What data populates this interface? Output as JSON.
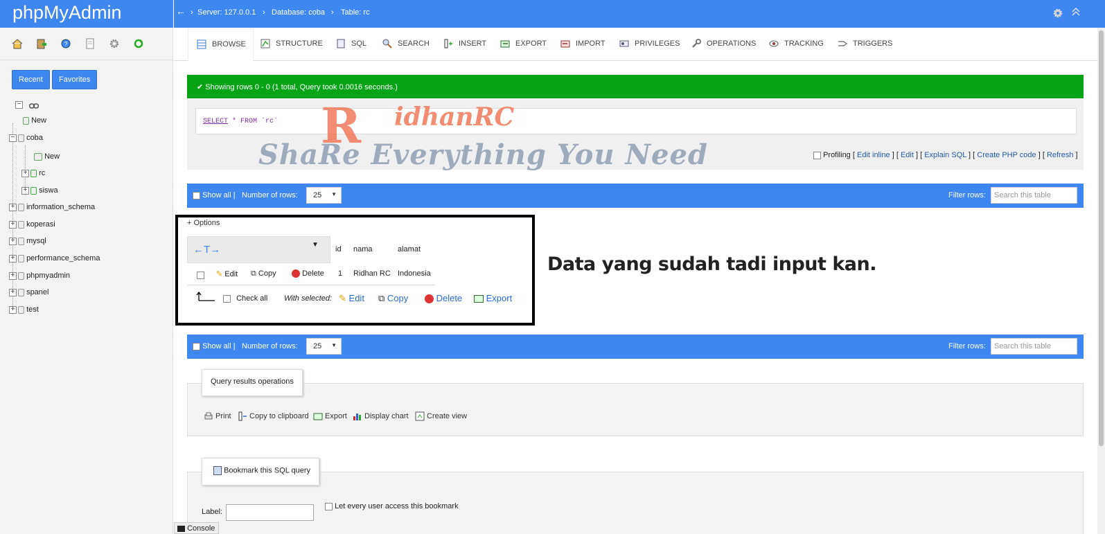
{
  "app": {
    "title": "phpMyAdmin"
  },
  "breadcrumb": {
    "back": "←",
    "server": "Server: 127.0.0.1",
    "database": "Database: coba",
    "table": "Table: rc"
  },
  "sidebar": {
    "recent_label": "Recent",
    "favorites_label": "Favorites",
    "tree": [
      {
        "label": "New"
      },
      {
        "label": "coba"
      },
      {
        "label": "New"
      },
      {
        "label": "rc"
      },
      {
        "label": "siswa"
      },
      {
        "label": "information_schema"
      },
      {
        "label": "koperasi"
      },
      {
        "label": "mysql"
      },
      {
        "label": "performance_schema"
      },
      {
        "label": "phpmyadmin"
      },
      {
        "label": "spanel"
      },
      {
        "label": "test"
      }
    ]
  },
  "tabs": [
    {
      "label": "Browse",
      "icon": "browse-icon"
    },
    {
      "label": "Structure",
      "icon": "structure-icon"
    },
    {
      "label": "SQL",
      "icon": "sql-icon"
    },
    {
      "label": "Search",
      "icon": "search-icon"
    },
    {
      "label": "Insert",
      "icon": "insert-icon"
    },
    {
      "label": "Export",
      "icon": "export-icon"
    },
    {
      "label": "Import",
      "icon": "import-icon"
    },
    {
      "label": "Privileges",
      "icon": "privileges-icon"
    },
    {
      "label": "Operations",
      "icon": "operations-icon"
    },
    {
      "label": "Tracking",
      "icon": "tracking-icon"
    },
    {
      "label": "Triggers",
      "icon": "triggers-icon"
    }
  ],
  "result": {
    "message": "Showing rows 0 - 0 (1 total, Query took 0.0016 seconds.)",
    "sql_select": "SELECT",
    "sql_rest": " * FROM `rc`",
    "profiling": "Profiling",
    "edit_inline": "Edit inline",
    "edit": "Edit",
    "explain": "Explain SQL",
    "create_php": "Create PHP code",
    "refresh": "Refresh"
  },
  "navbar": {
    "show_all": "Show all",
    "number_of_rows": "Number of rows:",
    "rows_value": "25",
    "filter_label": "Filter rows:",
    "filter_placeholder": "Search this table"
  },
  "table": {
    "options": "+ Options",
    "arrows": "←T→",
    "columns": [
      "id",
      "nama",
      "alamat"
    ],
    "row": {
      "edit": "Edit",
      "copy": "Copy",
      "delete": "Delete",
      "id": "1",
      "nama": "Ridhan RC",
      "alamat": "Indonesia"
    },
    "check_all": "Check all",
    "with_selected": "With selected:",
    "bulk": {
      "edit": "Edit",
      "copy": "Copy",
      "delete": "Delete",
      "export": "Export"
    }
  },
  "annotation": "Data yang sudah tadi input kan.",
  "watermark": {
    "line1": "idhanRC",
    "line2": "ShaRe Everything You Need"
  },
  "query_ops": {
    "legend": "Query results operations",
    "print": "Print",
    "copy_clipboard": "Copy to clipboard",
    "export": "Export",
    "display_chart": "Display chart",
    "create_view": "Create view"
  },
  "bookmark": {
    "legend": "Bookmark this SQL query",
    "label": "Label:",
    "every_user": "Let every user access this bookmark"
  },
  "console": {
    "label": "Console"
  },
  "colors": {
    "brand": "#3e86f0",
    "success": "#04a416"
  }
}
